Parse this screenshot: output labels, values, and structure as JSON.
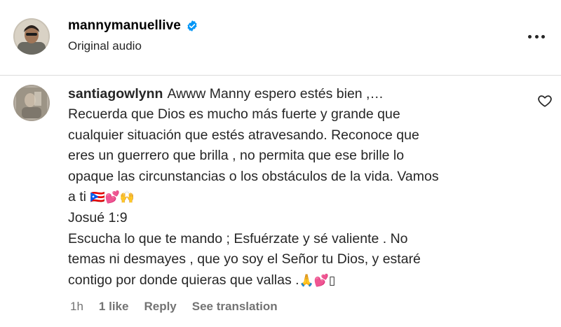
{
  "header": {
    "username": "mannymanuellive",
    "subtitle": "Original audio",
    "verified_color": "#0095F6"
  },
  "comment": {
    "username": "santiagowlynn",
    "lines": [
      "Awww Manny espero estés bien ,…",
      "Recuerda que Dios es mucho más fuerte y grande que",
      "cualquier situación que estés atravesando. Reconoce que",
      "eres un guerrero que brilla , no permita que ese brille lo",
      "opaque las circunstancias o los obstáculos de la vida. Vamos",
      "a ti",
      "Josué 1:9",
      "Escucha lo que te mando ; Esfuérzate y sé valiente . No",
      "temas ni desmayes , que yo soy el Señor tu Dios, y estaré",
      "contigo por donde quieras que vallas ."
    ],
    "emoji_line6": "🇵🇷💕🙌",
    "emoji_line10": "🙏💕▯",
    "time": "1h",
    "likes": "1 like",
    "reply": "Reply",
    "see_translation": "See translation"
  },
  "icons": {
    "verified": "verified-badge-icon",
    "more": "more-options-icon",
    "like": "heart-outline-icon"
  }
}
